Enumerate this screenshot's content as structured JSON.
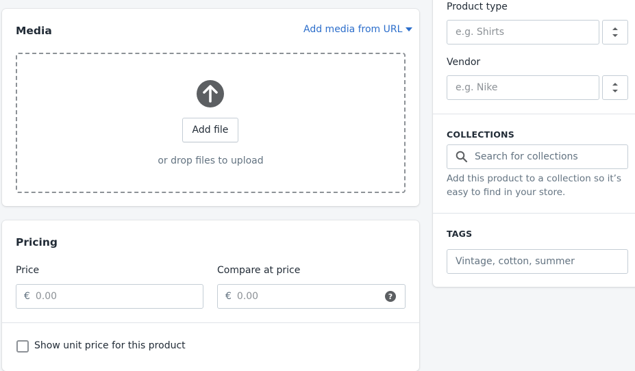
{
  "media": {
    "title": "Media",
    "add_from_url": "Add media from URL",
    "add_file": "Add file",
    "drop_hint": "or drop files to upload"
  },
  "pricing": {
    "title": "Pricing",
    "price_label": "Price",
    "price_currency": "€",
    "price_placeholder": "0.00",
    "compare_label": "Compare at price",
    "compare_currency": "€",
    "compare_placeholder": "0.00",
    "help_icon": "?",
    "unit_price_label": "Show unit price for this product"
  },
  "organization": {
    "product_type_label": "Product type",
    "product_type_placeholder": "e.g. Shirts",
    "vendor_label": "Vendor",
    "vendor_placeholder": "e.g. Nike"
  },
  "collections": {
    "heading": "COLLECTIONS",
    "search_placeholder": "Search for collections",
    "help_line1": "Add this product to a collection so it’s",
    "help_line2": "easy to find in your store."
  },
  "tags": {
    "heading": "TAGS",
    "placeholder": "Vintage, cotton, summer"
  }
}
